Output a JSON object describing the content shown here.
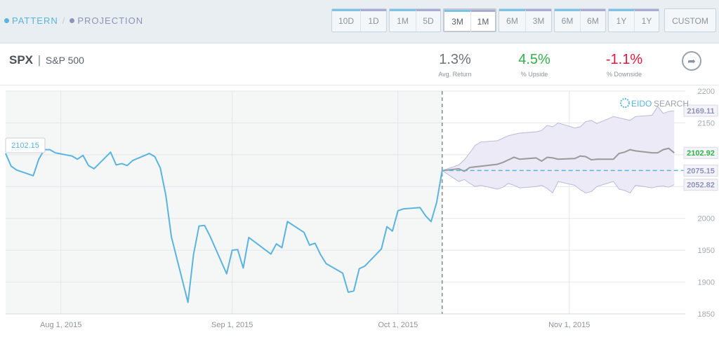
{
  "legend": {
    "pattern": "PATTERN",
    "separator": "/",
    "projection": "PROJECTION"
  },
  "buttons": [
    {
      "a": "10D",
      "b": "1D",
      "active": false
    },
    {
      "a": "1M",
      "b": "5D",
      "active": false
    },
    {
      "a": "3M",
      "b": "1M",
      "active": true
    },
    {
      "a": "6M",
      "b": "3M",
      "active": false
    },
    {
      "a": "6M",
      "b": "6M",
      "active": false
    },
    {
      "a": "1Y",
      "b": "1Y",
      "active": false
    }
  ],
  "custom_label": "CUSTOM",
  "ticker": {
    "symbol": "SPX",
    "separator": "|",
    "name": "S&P 500"
  },
  "stats": [
    {
      "value": "1.3%",
      "label": "Avg. Return",
      "color": "#6d747a"
    },
    {
      "value": "4.5%",
      "label": "% Upside",
      "color": "#2fb14a"
    },
    {
      "value": "-1.1%",
      "label": "% Downside",
      "color": "#e0163a"
    }
  ],
  "watermark": {
    "part1": "EIDO",
    "part2": "SEARCH"
  },
  "colors": {
    "pattern": "#5ab4de",
    "projection": "#8f93b8",
    "band": "#ebeaf6",
    "mean": "#9a9a9a",
    "plot_bg": "#f5f6f6"
  },
  "chart_data": {
    "type": "line",
    "ylim": [
      1850,
      2200
    ],
    "y_ticks": [
      1850,
      1900,
      1950,
      2000,
      2050,
      2100,
      2150,
      2200
    ],
    "x_tick_labels": [
      "Aug 1, 2015",
      "Sep 1, 2015",
      "Oct 1, 2015",
      "Nov 1, 2015"
    ],
    "x_tick_dates": [
      "2015-08-01",
      "2015-09-01",
      "2015-10-01",
      "2015-11-01"
    ],
    "x_range": [
      "2015-07-22",
      "2015-11-22"
    ],
    "split_date": "2015-10-09",
    "pattern_series": {
      "x": [
        "2015-07-22",
        "2015-07-23",
        "2015-07-24",
        "2015-07-27",
        "2015-07-28",
        "2015-07-29",
        "2015-07-30",
        "2015-07-31",
        "2015-08-03",
        "2015-08-04",
        "2015-08-05",
        "2015-08-06",
        "2015-08-07",
        "2015-08-10",
        "2015-08-11",
        "2015-08-12",
        "2015-08-13",
        "2015-08-14",
        "2015-08-17",
        "2015-08-18",
        "2015-08-19",
        "2015-08-20",
        "2015-08-21",
        "2015-08-24",
        "2015-08-25",
        "2015-08-26",
        "2015-08-27",
        "2015-08-28",
        "2015-08-31",
        "2015-09-01",
        "2015-09-02",
        "2015-09-03",
        "2015-09-04",
        "2015-09-08",
        "2015-09-09",
        "2015-09-10",
        "2015-09-11",
        "2015-09-14",
        "2015-09-15",
        "2015-09-16",
        "2015-09-17",
        "2015-09-18",
        "2015-09-21",
        "2015-09-22",
        "2015-09-23",
        "2015-09-24",
        "2015-09-25",
        "2015-09-28",
        "2015-09-29",
        "2015-09-30",
        "2015-10-01",
        "2015-10-02",
        "2015-10-05",
        "2015-10-06",
        "2015-10-07",
        "2015-10-08",
        "2015-10-09"
      ],
      "values": [
        2102.15,
        2082,
        2076,
        2067,
        2093,
        2108,
        2108,
        2103,
        2098,
        2093,
        2099,
        2083,
        2078,
        2104,
        2084,
        2086,
        2083,
        2091,
        2102,
        2097,
        2079,
        2036,
        1971,
        1868,
        1943,
        1988,
        1989,
        1972,
        1913,
        1950,
        1951,
        1922,
        1970,
        1944,
        1960,
        1954,
        1995,
        1978,
        1958,
        1961,
        1943,
        1929,
        1914,
        1884,
        1886,
        1921,
        1925,
        1952,
        1987,
        1980,
        2012,
        2015,
        2017,
        2004,
        1995,
        2025,
        2075.15
      ]
    },
    "projection": {
      "x": [
        "2015-10-09",
        "2015-10-12",
        "2015-10-13",
        "2015-10-14",
        "2015-10-15",
        "2015-10-16",
        "2015-10-19",
        "2015-10-20",
        "2015-10-21",
        "2015-10-22",
        "2015-10-23",
        "2015-10-26",
        "2015-10-27",
        "2015-10-28",
        "2015-10-29",
        "2015-10-30",
        "2015-11-02",
        "2015-11-03",
        "2015-11-04",
        "2015-11-05",
        "2015-11-06",
        "2015-11-09",
        "2015-11-10",
        "2015-11-11",
        "2015-11-12",
        "2015-11-13",
        "2015-11-16",
        "2015-11-17",
        "2015-11-18",
        "2015-11-19",
        "2015-11-20"
      ],
      "mean": [
        2075,
        2078,
        2074,
        2080,
        2081,
        2082,
        2085,
        2088,
        2092,
        2096,
        2093,
        2095,
        2090,
        2096,
        2095,
        2093,
        2094,
        2098,
        2097,
        2092,
        2093,
        2093,
        2102,
        2104,
        2108,
        2106,
        2103,
        2103,
        2108,
        2110,
        2102.92
      ],
      "upper": [
        2075,
        2084,
        2092,
        2103,
        2115,
        2120,
        2122,
        2126,
        2130,
        2132,
        2134,
        2136,
        2138,
        2146,
        2144,
        2150,
        2142,
        2144,
        2152,
        2154,
        2149,
        2160,
        2158,
        2156,
        2154,
        2160,
        2162,
        2176,
        2165,
        2168,
        2169.11
      ],
      "lower": [
        2075,
        2058,
        2061,
        2055,
        2050,
        2052,
        2046,
        2049,
        2055,
        2052,
        2048,
        2050,
        2052,
        2047,
        2040,
        2058,
        2052,
        2045,
        2040,
        2042,
        2050,
        2058,
        2046,
        2044,
        2040,
        2052,
        2048,
        2050,
        2051,
        2049,
        2052.82
      ]
    },
    "end_labels": {
      "pattern": "2102.15",
      "upper": "2169.11",
      "mean": "2102.92",
      "current": "2075.15",
      "lower": "2052.82"
    },
    "grid": true,
    "legend_position": "top-left"
  }
}
